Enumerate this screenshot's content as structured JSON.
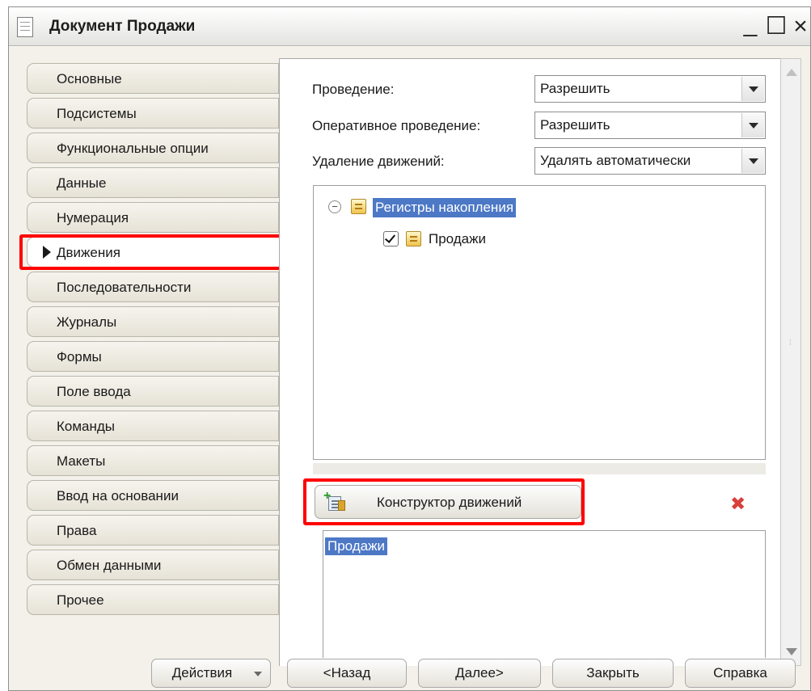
{
  "window": {
    "title": "Документ Продажи",
    "controls": {
      "minimize": "_",
      "maximize": "☐",
      "close": "×"
    }
  },
  "tabs": [
    {
      "label": "Основные",
      "active": false
    },
    {
      "label": "Подсистемы",
      "active": false
    },
    {
      "label": "Функциональные опции",
      "active": false
    },
    {
      "label": "Данные",
      "active": false
    },
    {
      "label": "Нумерация",
      "active": false
    },
    {
      "label": "Движения",
      "active": true
    },
    {
      "label": "Последовательности",
      "active": false
    },
    {
      "label": "Журналы",
      "active": false
    },
    {
      "label": "Формы",
      "active": false
    },
    {
      "label": "Поле ввода",
      "active": false
    },
    {
      "label": "Команды",
      "active": false
    },
    {
      "label": "Макеты",
      "active": false
    },
    {
      "label": "Ввод на основании",
      "active": false
    },
    {
      "label": "Права",
      "active": false
    },
    {
      "label": "Обмен данными",
      "active": false
    },
    {
      "label": "Прочее",
      "active": false
    }
  ],
  "fields": {
    "posting": {
      "label": "Проведение:",
      "value": "Разрешить"
    },
    "realtime_posting": {
      "label": "Оперативное проведение:",
      "value": "Разрешить"
    },
    "delete_movements": {
      "label": "Удаление движений:",
      "value": "Удалять автоматически"
    }
  },
  "tree": {
    "root": {
      "label": "Регистры накопления",
      "expanded": true
    },
    "children": [
      {
        "label": "Продажи",
        "checked": true
      }
    ]
  },
  "constructor_button": {
    "label": "Конструктор движений"
  },
  "movements_list": [
    "Продажи"
  ],
  "footer": {
    "actions": "Действия",
    "back": "<Назад",
    "next": "Далее>",
    "close": "Закрыть",
    "help": "Справка"
  },
  "colors": {
    "selection": "#4c78c6",
    "highlight": "#ff0000",
    "delete_icon": "#d8403a"
  }
}
